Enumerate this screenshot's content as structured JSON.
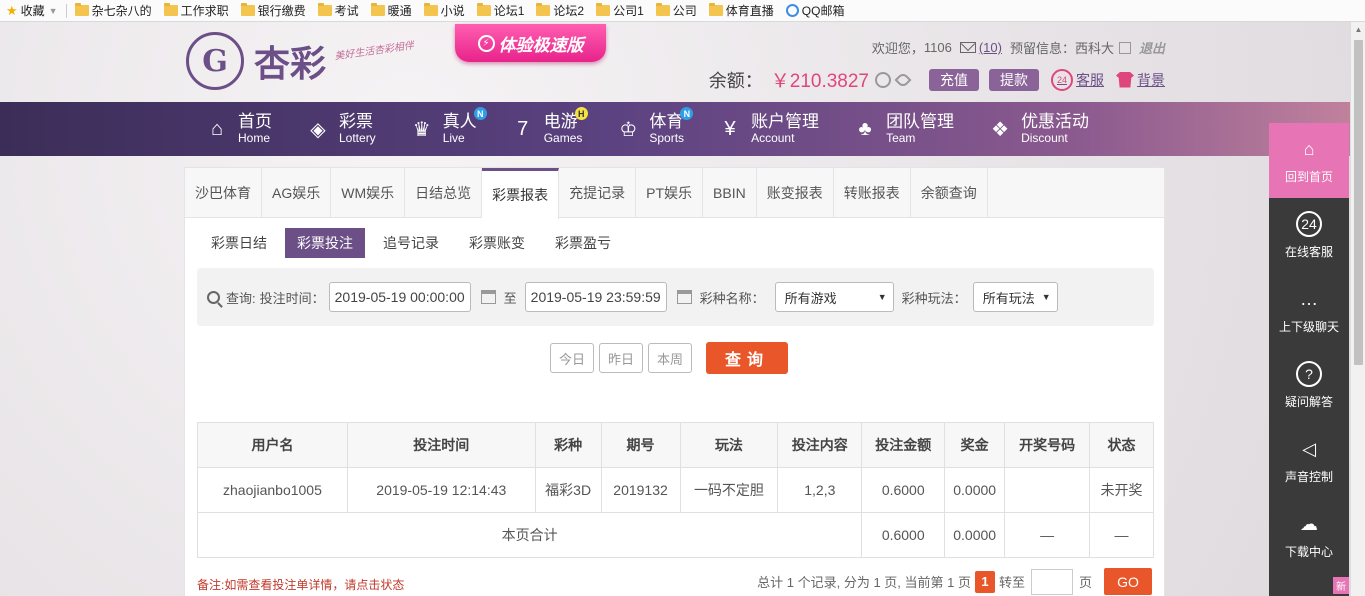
{
  "bookmarks": {
    "favorites": "收藏",
    "folders": [
      "杂七杂八的",
      "工作求职",
      "银行缴费",
      "考试",
      "暖通",
      "小说",
      "论坛1",
      "论坛2",
      "公司1",
      "公司",
      "体育直播"
    ],
    "qq_mail": "QQ邮箱"
  },
  "header": {
    "logo_text": "杏彩",
    "slogan": "美好生活杏彩相伴",
    "speed_badge": "体验极速版",
    "welcome": "欢迎您，",
    "username": "1106",
    "mail_count": "(10)",
    "reserved_info": "预留信息：",
    "reserved_value": "西科大",
    "logout": "退出",
    "balance_label": "余额：",
    "balance_value": "￥210.3827",
    "recharge": "充值",
    "withdraw": "提款",
    "service": "客服",
    "background": "背景"
  },
  "nav": {
    "items": [
      {
        "cn": "首页",
        "en": "Home",
        "icon": "⌂",
        "badge": ""
      },
      {
        "cn": "彩票",
        "en": "Lottery",
        "icon": "◈",
        "badge": ""
      },
      {
        "cn": "真人",
        "en": "Live",
        "icon": "♛",
        "badge": "N"
      },
      {
        "cn": "电游",
        "en": "Games",
        "icon": "7",
        "badge": "H"
      },
      {
        "cn": "体育",
        "en": "Sports",
        "icon": "♔",
        "badge": "N"
      },
      {
        "cn": "账户管理",
        "en": "Account",
        "icon": "¥",
        "badge": ""
      },
      {
        "cn": "团队管理",
        "en": "Team",
        "icon": "♣",
        "badge": ""
      },
      {
        "cn": "优惠活动",
        "en": "Discount",
        "icon": "❖",
        "badge": ""
      }
    ]
  },
  "tabs": [
    "沙巴体育",
    "AG娱乐",
    "WM娱乐",
    "日结总览",
    "彩票报表",
    "充提记录",
    "PT娱乐",
    "BBIN",
    "账变报表",
    "转账报表",
    "余额查询"
  ],
  "active_tab": 4,
  "subtabs": [
    "彩票日结",
    "彩票投注",
    "追号记录",
    "彩票账变",
    "彩票盈亏"
  ],
  "active_subtab": 1,
  "filter": {
    "query_label": "查询:",
    "time_label": "投注时间：",
    "start": "2019-05-19 00:00:00",
    "to": "至",
    "end": "2019-05-19 23:59:59",
    "game_label": "彩种名称：",
    "game_value": "所有游戏",
    "play_label": "彩种玩法：",
    "play_value": "所有玩法"
  },
  "quick": {
    "today": "今日",
    "yesterday": "昨日",
    "week": "本周",
    "search": "查询"
  },
  "table": {
    "headers": [
      "用户名",
      "投注时间",
      "彩种",
      "期号",
      "玩法",
      "投注内容",
      "投注金额",
      "奖金",
      "开奖号码",
      "状态"
    ],
    "rows": [
      [
        "zhaojianbo1005",
        "2019-05-19 12:14:43",
        "福彩3D",
        "2019132",
        "一码不定胆",
        "1,2,3",
        "0.6000",
        "0.0000",
        "",
        "未开奖"
      ]
    ],
    "total_label": "本页合计",
    "total_amount": "0.6000",
    "total_bonus": "0.0000",
    "total_dash1": "—",
    "total_dash2": "—"
  },
  "footer": {
    "note": "备注:如需查看投注单详情，请点击状态",
    "summary": "总计 1 个记录, 分为 1 页, 当前第 1 页",
    "current_page": "1",
    "goto": "转至",
    "page": "页",
    "go": "GO"
  },
  "sidebar": {
    "items": [
      {
        "label": "回到首页",
        "icon": "⌂"
      },
      {
        "label": "在线客服",
        "icon": "24"
      },
      {
        "label": "上下级聊天",
        "icon": "…"
      },
      {
        "label": "疑问解答",
        "icon": "?"
      },
      {
        "label": "声音控制",
        "icon": "◁"
      },
      {
        "label": "下载中心",
        "icon": "☁"
      }
    ],
    "new_badge": "新"
  },
  "colors": {
    "brand": "#6b4f86",
    "accent": "#e8562a",
    "pink": "#e774b4"
  }
}
